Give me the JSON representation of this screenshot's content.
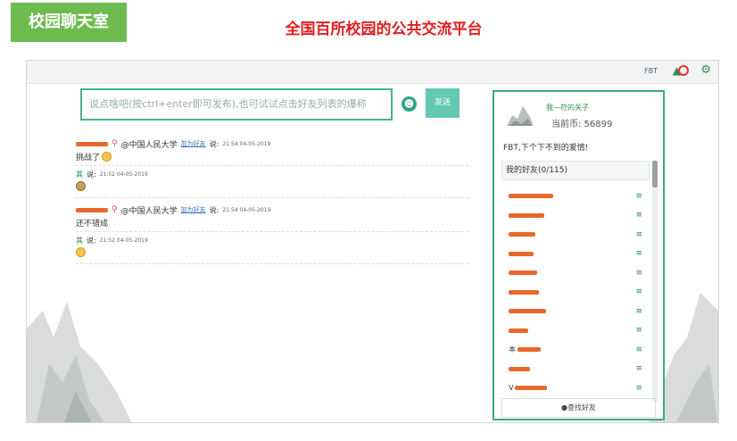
{
  "header": {
    "tag_title": "校园聊天室",
    "headline": "全国百所校园的公共交流平台"
  },
  "topbar": {
    "user": "FBT"
  },
  "composer": {
    "placeholder": "说点啥吧(按ctrl+enter即可发布),也可试试点击好友列表的爆称",
    "send_label": "发送"
  },
  "feed": {
    "posts": [
      {
        "school": "@中国人民大学",
        "link": "加为好友",
        "said": "说:",
        "time": "21:54 04-05-2019",
        "body": "挑战了",
        "reply": {
          "name": "其",
          "said": "说:",
          "time": "21:52 04-05-2019"
        }
      },
      {
        "school": "@中国人民大学",
        "link": "加为好友",
        "said": "说:",
        "time": "21:54 04-05-2019",
        "body": "还不错成",
        "reply": {
          "name": "其",
          "said": "说:",
          "time": "21:52 04-05-2019"
        }
      }
    ]
  },
  "panel": {
    "profile_name": "我—符的关子",
    "coins": "当前币: 56899",
    "message": "FBT,下个下不到的爱情!",
    "friends_header": "我的好友(0/115)",
    "friends": [
      {
        "name": ""
      },
      {
        "name": ""
      },
      {
        "name": ""
      },
      {
        "name": ""
      },
      {
        "name": ""
      },
      {
        "name": ""
      },
      {
        "name": ""
      },
      {
        "name": ""
      },
      {
        "name": "本"
      },
      {
        "name": ""
      },
      {
        "name": "V"
      }
    ],
    "footer": "●查找好友"
  },
  "colors": {
    "tag_bg": "#6dbb4e",
    "headline": "#e02020",
    "accent": "#3aa789",
    "send_btn": "#63c9b4",
    "redaction": "#e8672b"
  }
}
